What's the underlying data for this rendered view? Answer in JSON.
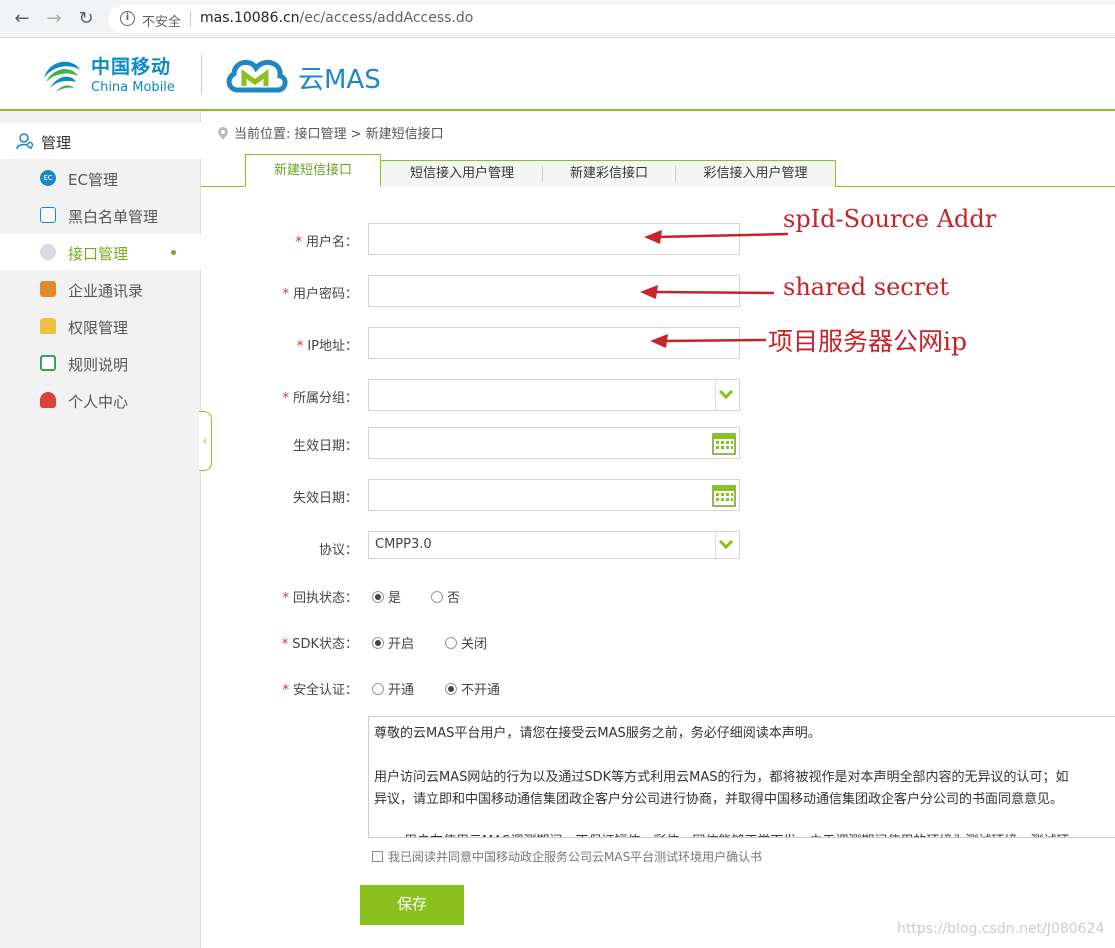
{
  "browser": {
    "insecure_label": "不安全",
    "url_host": "mas.10086.cn",
    "url_path": "/ec/access/addAccess.do"
  },
  "header": {
    "cm_cn": "中国移动",
    "cm_en": "China Mobile",
    "product": "云MAS"
  },
  "sidebar": {
    "title": "管理",
    "items": [
      {
        "label": "EC管理",
        "icon": "ec-icon",
        "color": "#1e88c7"
      },
      {
        "label": "黑白名单管理",
        "icon": "contact-card-icon",
        "color": "#1e88c7"
      },
      {
        "label": "接口管理",
        "icon": "gear-icon",
        "color": "#b0b8c8",
        "active": true
      },
      {
        "label": "企业通讯录",
        "icon": "address-book-icon",
        "color": "#e08a2c"
      },
      {
        "label": "权限管理",
        "icon": "lock-icon",
        "color": "#e0a020"
      },
      {
        "label": "规则说明",
        "icon": "document-icon",
        "color": "#3aa060"
      },
      {
        "label": "个人中心",
        "icon": "user-icon",
        "color": "#d9433a"
      }
    ]
  },
  "breadcrumb": "当前位置: 接口管理 > 新建短信接口",
  "tabs": [
    "新建短信接口",
    "短信接入用户管理",
    "新建彩信接口",
    "彩信接入用户管理"
  ],
  "form": {
    "username_label": "用户名：",
    "password_label": "用户密码：",
    "ip_label": "IP地址：",
    "group_label": "所属分组：",
    "start_label": "生效日期：",
    "end_label": "失效日期：",
    "protocol_label": "协议：",
    "protocol_value": "CMPP3.0",
    "receipt_label": "回执状态：",
    "receipt_options": [
      "是",
      "否"
    ],
    "sdk_label": "SDK状态：",
    "sdk_options": [
      "开启",
      "关闭"
    ],
    "auth_label": "安全认证：",
    "auth_options": [
      "开通",
      "不开通"
    ],
    "required_mark": "*"
  },
  "disclaimer": {
    "line1": "尊敬的云MAS平台用户，请您在接受云MAS服务之前，务必仔细阅读本声明。",
    "line2": "用户访问云MAS网站的行为以及通过SDK等方式利用云MAS的行为，都将被视作是对本声明全部内容的无异议的认可；如",
    "line3": "异议，请立即和中国移动通信集团政企客户分公司进行协商，并取得中国移动通信集团政企客户分公司的书面同意意见。",
    "line4": "用户在使用云MAS调测期间，不保证短信、彩信、网信能够正常下发，由于调测期间使用的环境为测试环境，测试环"
  },
  "agree_text": "我已阅读并同意中国移动政企服务公司云MAS平台测试环境用户确认书",
  "save_label": "保存",
  "annotations": {
    "a1": "spId-Source Addr",
    "a2": "shared secret",
    "a3": "项目服务器公网ip"
  },
  "watermark": "https://blog.csdn.net/J080624",
  "colors": {
    "accent": "#8bc11f",
    "brand": "#1e88c7",
    "annotation": "#c8232b"
  }
}
